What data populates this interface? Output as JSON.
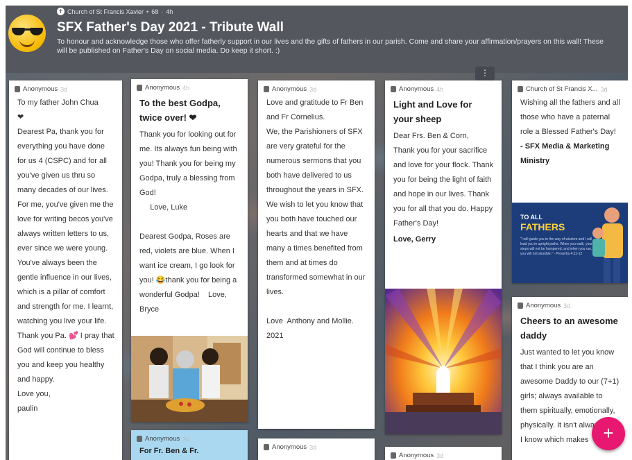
{
  "header": {
    "org": "Church of St Francis Xavier",
    "likes": "68",
    "dot": "•",
    "sep": "·",
    "age": "4h",
    "title": "SFX Father's Day 2021 - Tribute Wall",
    "description": "To honour and acknowledge those who offer fatherly support in our lives and the gifts of fathers in our parish. Come and share your affirmation/prayers on this wall! These will be published on Father's Day on social media. Do keep it short. :)"
  },
  "posts": [
    {
      "author": "Anonymous",
      "age": "3d",
      "subject": "",
      "body": "To my father John Chua\n❤\nDearest Pa, thank you for everything you have done for us 4 (CSPC) and for all you've given us thru so many decades of our lives.  For me, you've given me the love for writing becos you've always written letters to us, ever since we were young. You've always been the gentle influence in our lives, which is a pillar of comfort and strength for me. I learnt, watching you live your life. Thank you Pa. 💕 I pray that God will continue to bless you and keep you healthy and happy.\nLove you,\npaulin"
    },
    {
      "author": "Anonymous",
      "age": "4h",
      "subject": "To the best Godpa, twice over! ❤",
      "body": "Thank you for looking out for me. Its always fun being with you! Thank you for being my Godpa, truly a blessing from God!\n     Love, Luke\n\nDearest Godpa, Roses are red, violets are blue. When I want ice cream, I go look for you! 😂thank you for being a wonderful Godpa!    Love, Bryce"
    },
    {
      "author": "Anonymous",
      "age": "3d",
      "subject": "",
      "body": "Love and gratitude to Fr Ben and Fr Cornelius.\nWe, the Parishioners of SFX are very grateful for the numerous sermons that you both have delivered to us throughout the years in SFX.\nWe wish to let you know that you both have touched our hearts and that we have many a times benefited from them and at times do transformed somewhat in our lives.\n\nLove  Anthony and Mollie. 2021"
    },
    {
      "author": "Anonymous",
      "age": "4h",
      "subject": "Light and Love for your sheep",
      "body": "Dear Frs. Ben & Corn,\nThank you for your sacrifice and love for your flock. Thank you for being the light of faith and hope in our lives. Thank you for all that you do. Happy Father's Day!",
      "signature": "Love, Gerry"
    },
    {
      "author": "Church of St Francis X...",
      "age": "3d",
      "subject": "",
      "body": "Wishing all the fathers and all those who have a paternal role a Blessed Father's Day!",
      "signature": "- SFX Media & Marketing Ministry",
      "banner_line1": "TO ALL",
      "banner_line2": "FATHERS",
      "banner_quote": "\"I will guide you in the way of wisdom and I will lead you in upright paths. When you walk, your steps will not be hampered, and when you run, you will not stumble.\" - Proverbs 4:11-12"
    },
    {
      "author": "Anonymous",
      "age": "3d",
      "subject": "Cheers to an awesome daddy",
      "body": "Just wanted to let you know that I think you are an awesome Daddy to our (7+1) girls; always available to them spiritually, emotionally, physically. It isn't always easy I know which makes"
    },
    {
      "author": "Anonymous",
      "age": "3d",
      "subject": "For Fr. Ben & Fr.",
      "body": ""
    },
    {
      "author": "Anonymous",
      "age": "3d",
      "subject": "",
      "body": ""
    },
    {
      "author": "Anonymous",
      "age": "3d",
      "subject": "",
      "body": ""
    }
  ],
  "column_menu_icon": "⋮",
  "fab_label": "+",
  "colors": {
    "header": "#54575e",
    "fab": "#e8176f",
    "heart": "#e0243a",
    "banner_bg": "#1d3d7a",
    "banner_accent": "#ffd23c"
  },
  "icons": {
    "avatar": "sunglasses-emoji",
    "church": "church-icon",
    "user": "user-icon",
    "add": "plus-icon"
  }
}
